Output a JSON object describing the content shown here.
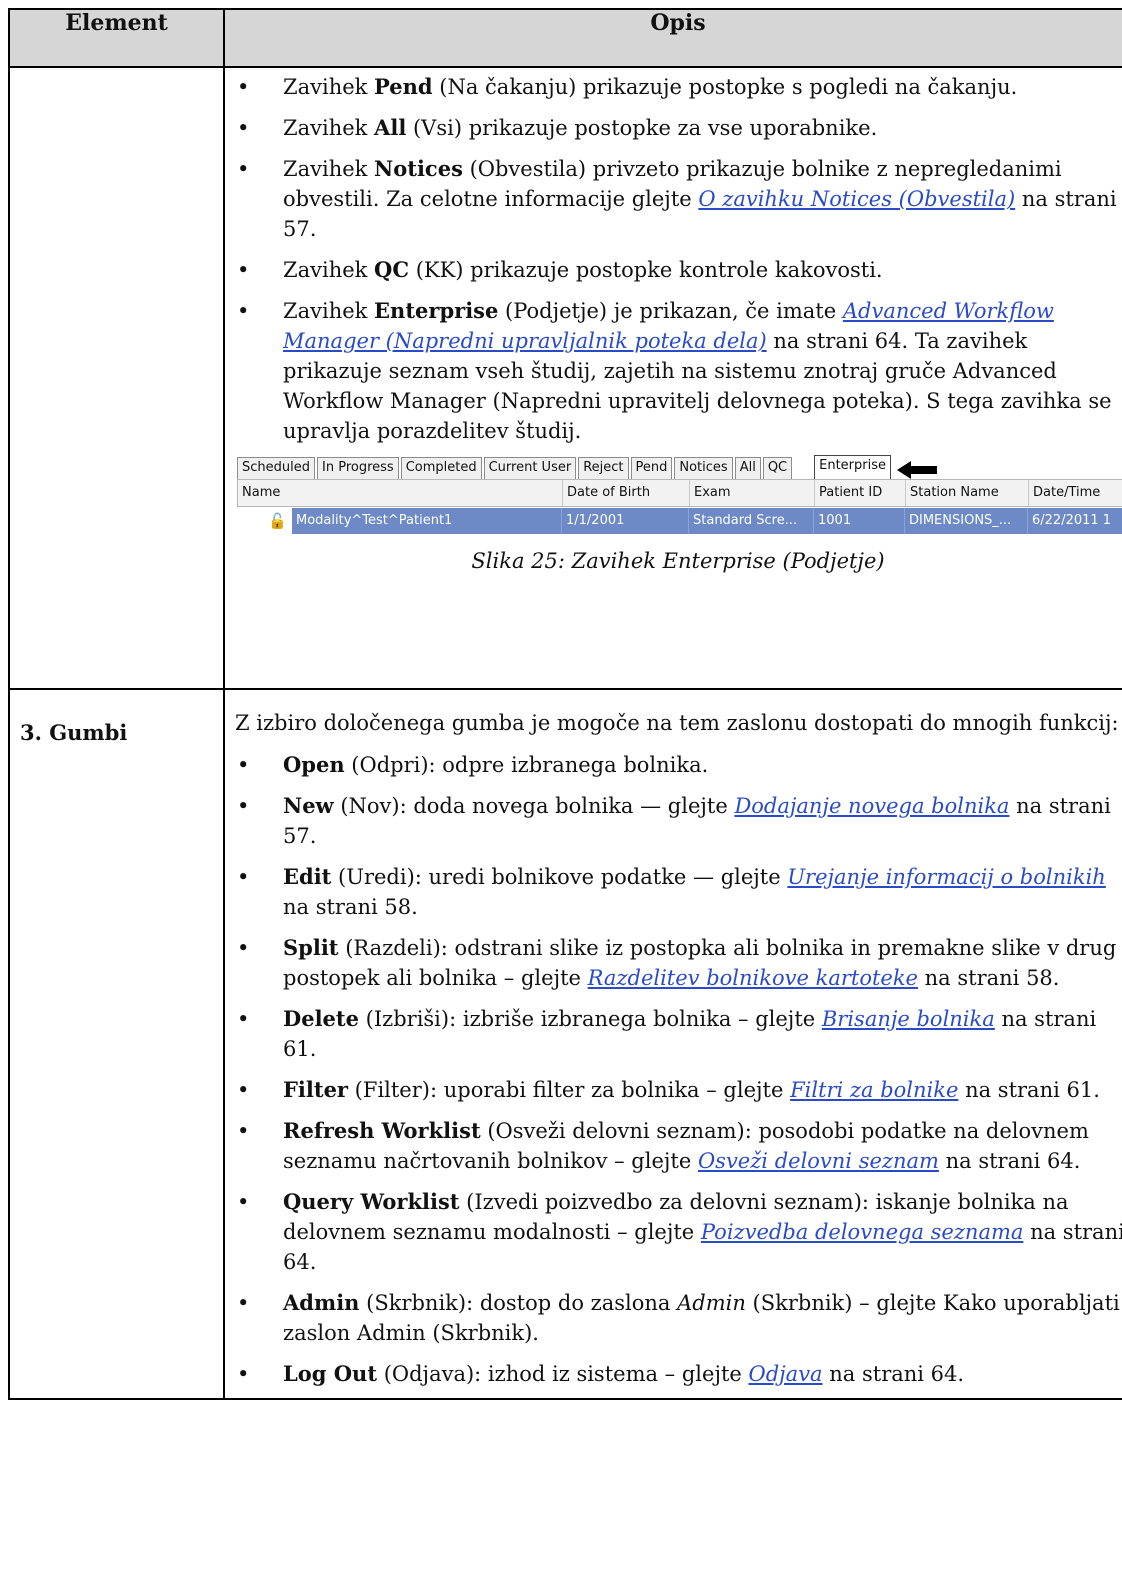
{
  "table": {
    "headers": {
      "element": "Element",
      "description": "Opis"
    },
    "row1": {
      "bullets": [
        {
          "prefix": "Zavihek ",
          "bold": "Pend",
          "suffix": " (Na čakanju) prikazuje postopke s pogledi na čakanju."
        },
        {
          "prefix": "Zavihek ",
          "bold": "All",
          "suffix": " (Vsi) prikazuje postopke za vse uporabnike."
        },
        {
          "prefix": "Zavihek ",
          "bold": "Notices",
          "suffix": " (Obvestila) privzeto prikazuje bolnike z nepregledanimi obvestili. Za celotne informacije glejte ",
          "link": "O zavihku Notices (Obvestila)",
          "after": " na strani 57."
        },
        {
          "prefix": "Zavihek ",
          "bold": "QC",
          "suffix": " (KK) prikazuje postopke kontrole kakovosti."
        },
        {
          "prefix": "Zavihek ",
          "bold": "Enterprise",
          "suffix": " (Podjetje) je prikazan, če imate ",
          "link": "Advanced Workflow Manager (Napredni upravljalnik poteka dela)",
          "after": " na strani 64. Ta zavihek prikazuje seznam vseh študij, zajetih na sistemu znotraj gruče Advanced Workflow Manager (Napredni upravitelj delovnega poteka). S tega zavihka se upravlja porazdelitev študij."
        }
      ],
      "screenshot": {
        "tabs": [
          "Scheduled",
          "In Progress",
          "Completed",
          "Current User",
          "Reject",
          "Pend",
          "Notices",
          "All",
          "QC"
        ],
        "selected_tab": "Enterprise",
        "columns": [
          "Name",
          "Date of Birth",
          "Exam",
          "Patient ID",
          "Station Name",
          "Date/Time"
        ],
        "row": [
          "Modality^Test^Patient1",
          "1/1/2001",
          "Standard Scre...",
          "1001",
          "DIMENSIONS_...",
          "6/22/2011 1"
        ],
        "highlight_color": "#6d89c6"
      },
      "caption": "Slika 25: Zavihek Enterprise (Podjetje)"
    },
    "row2": {
      "element": "3. Gumbi",
      "intro": "Z izbiro določenega gumba je mogoče na tem zaslonu dostopati do mnogih funkcij:",
      "bullets": [
        {
          "bold": "Open",
          "suffix": " (Odpri): odpre izbranega bolnika."
        },
        {
          "bold": "New",
          "suffix": " (Nov): doda novega bolnika — glejte ",
          "link": "Dodajanje novega bolnika",
          "after": " na strani 57."
        },
        {
          "bold": "Edit",
          "suffix": " (Uredi): uredi bolnikove podatke — glejte ",
          "link": "Urejanje informacij o bolnikih",
          "after": " na strani 58."
        },
        {
          "bold": "Split",
          "suffix": " (Razdeli): odstrani slike iz postopka ali bolnika in premakne slike v drug postopek ali bolnika – glejte ",
          "link": "Razdelitev bolnikove kartoteke",
          "after": " na strani 58."
        },
        {
          "bold": "Delete",
          "suffix": " (Izbriši): izbriše izbranega bolnika – glejte ",
          "link": "Brisanje bolnika",
          "after": " na strani 61."
        },
        {
          "bold": "Filter",
          "suffix": " (Filter): uporabi filter za bolnika – glejte ",
          "link": "Filtri za bolnike",
          "after": " na strani 61."
        },
        {
          "bold": "Refresh Worklist",
          "suffix": " (Osveži delovni seznam): posodobi podatke na delovnem seznamu načrtovanih bolnikov – glejte ",
          "link": "Osveži delovni seznam",
          "after": " na strani 64."
        },
        {
          "bold": "Query Worklist",
          "suffix": " (Izvedi poizvedbo za delovni seznam): iskanje bolnika na delovnem seznamu modalnosti – glejte ",
          "link": "Poizvedba delovnega seznama",
          "after": " na strani 64."
        },
        {
          "bold": "Admin",
          "suffix": " (Skrbnik): dostop do zaslona ",
          "italic": "Admin",
          "after": " (Skrbnik) – glejte Kako uporabljati zaslon Admin (Skrbnik)."
        },
        {
          "bold": "Log Out",
          "suffix": " (Odjava): izhod iz sistema – glejte ",
          "link": "Odjava",
          "after": " na strani 64."
        }
      ]
    }
  }
}
